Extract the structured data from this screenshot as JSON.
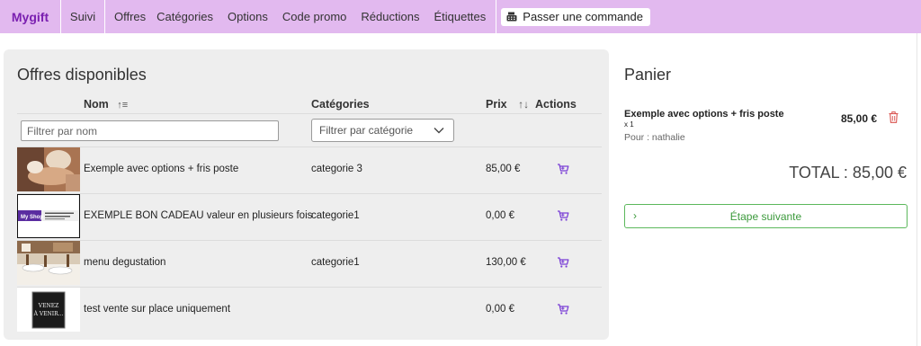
{
  "navbar": {
    "brand": "Mygift",
    "items": [
      "Suivi",
      "Offres",
      "Catégories",
      "Options",
      "Code promo",
      "Réductions",
      "Étiquettes"
    ],
    "order_button": "Passer une commande",
    "accent": "#e2b9ef",
    "brand_color": "#7a1fb0"
  },
  "offers": {
    "title": "Offres disponibles",
    "headers": {
      "name": "Nom",
      "category": "Catégories",
      "price": "Prix",
      "actions": "Actions"
    },
    "filter_name_placeholder": "Filtrer par nom",
    "filter_category_placeholder": "Filtrer par catégorie",
    "rows": [
      {
        "name": "Exemple avec options + fris poste",
        "category": "categorie 3",
        "price": "85,00 €",
        "thumb": "massage-photo"
      },
      {
        "name": "EXEMPLE BON CADEAU valeur en plusieurs fois",
        "category": "categorie1",
        "price": "0,00 €",
        "thumb": "my-shop-banner",
        "thumb_text": "My Shop"
      },
      {
        "name": "menu degustation",
        "category": "categorie1",
        "price": "130,00 €",
        "thumb": "restaurant-photo"
      },
      {
        "name": "test vente sur place uniquement",
        "category": "",
        "price": "0,00 €",
        "thumb": "chalkboard-sign",
        "thumb_text": "VENEZ À VENIR..."
      }
    ]
  },
  "cart": {
    "title": "Panier",
    "item": {
      "name": "Exemple avec options + fris poste",
      "qty": "x 1",
      "for": "Pour : nathalie",
      "price": "85,00 €"
    },
    "total": "TOTAL : 85,00 €",
    "next_button": "Étape suivante",
    "success_color": "#5cb85c",
    "delete_color": "#d9534f"
  }
}
